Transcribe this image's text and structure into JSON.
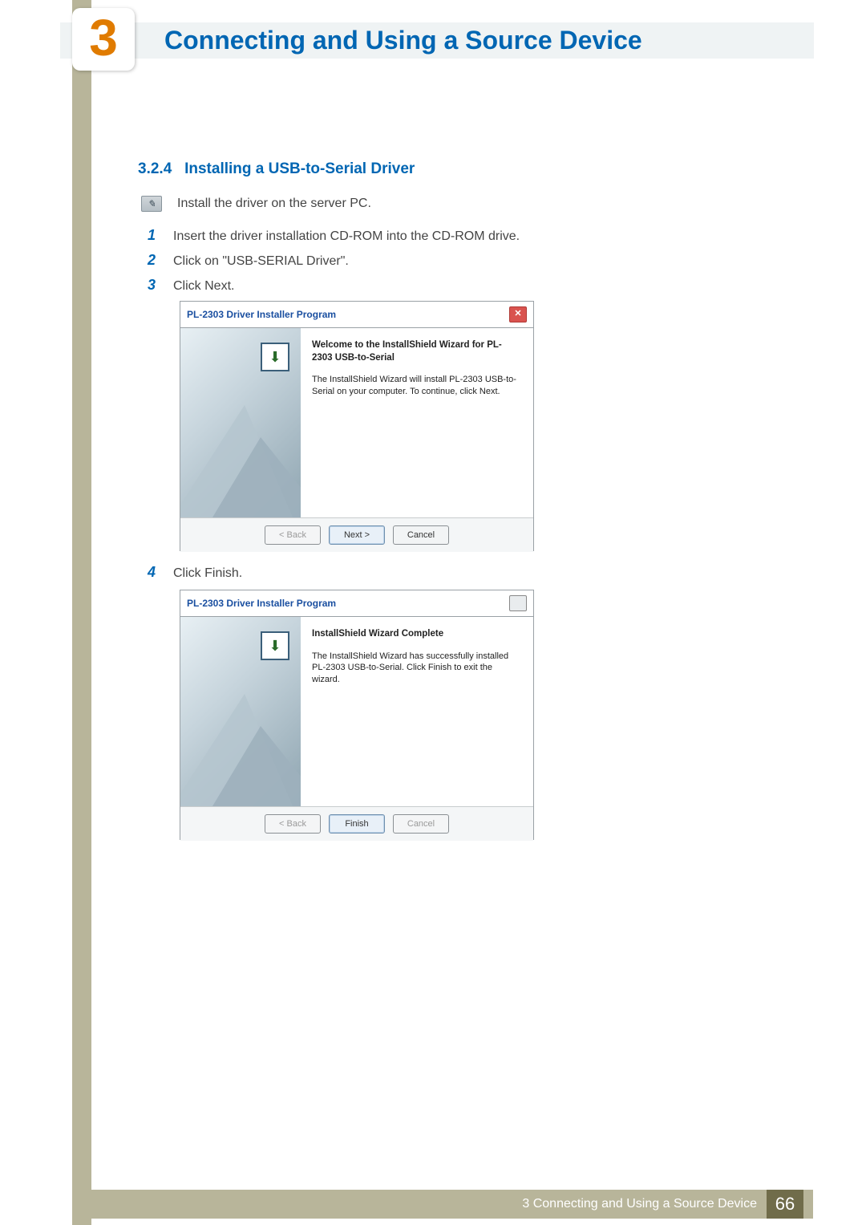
{
  "chapter": {
    "number": "3",
    "title": "Connecting and Using a Source Device"
  },
  "section": {
    "number": "3.2.4",
    "title": "Installing a USB-to-Serial Driver"
  },
  "note": "Install the driver on the server PC.",
  "steps": {
    "1": "Insert the driver installation CD-ROM into the CD-ROM drive.",
    "2": "Click on \"USB-SERIAL Driver\".",
    "3": "Click Next.",
    "4": "Click Finish."
  },
  "dialog1": {
    "title": "PL-2303 Driver Installer Program",
    "heading": "Welcome to the InstallShield Wizard for PL-2303 USB-to-Serial",
    "body": "The InstallShield Wizard will install PL-2303 USB-to-Serial on your computer.  To continue, click Next.",
    "buttons": {
      "back": "< Back",
      "next": "Next >",
      "cancel": "Cancel"
    }
  },
  "dialog2": {
    "title": "PL-2303 Driver Installer Program",
    "heading": "InstallShield Wizard Complete",
    "body": "The InstallShield Wizard has successfully installed PL-2303 USB-to-Serial.  Click Finish to exit the wizard.",
    "buttons": {
      "back": "< Back",
      "finish": "Finish",
      "cancel": "Cancel"
    }
  },
  "footer": {
    "text": "3 Connecting and Using a Source Device",
    "page": "66"
  }
}
